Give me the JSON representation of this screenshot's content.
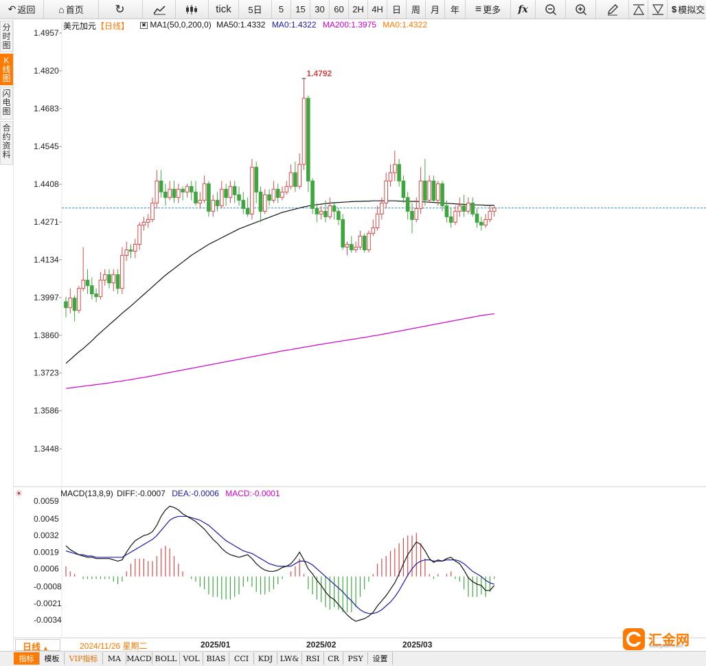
{
  "toolbar": {
    "back": "返回",
    "home": "首页",
    "tick": "tick",
    "five_day": "5日",
    "periods": [
      "5",
      "15",
      "30",
      "60",
      "2H",
      "4H",
      "日",
      "周",
      "月",
      "年"
    ],
    "more": "更多",
    "fx": "fx",
    "sim": "模拟交"
  },
  "left_tabs": [
    "分时图",
    "K线图",
    "闪电图",
    "合约资料"
  ],
  "main_legend": {
    "symbol": "美元加元",
    "period": "【日线】",
    "ma_set": "MA1(50,0,200,0)",
    "ma50": "MA50:1.4332",
    "ma0a": "MA0:1.4322",
    "ma200": "MA200:1.3975",
    "ma0b": "MA0:1.4322"
  },
  "macd_legend": {
    "name": "MACD(13,8,9)",
    "diff": "DIFF:-0.0007",
    "dea": "DEA:-0.0006",
    "macd": "MACD:-0.0001"
  },
  "max_label": "1.4792",
  "bottom": {
    "period": "日线",
    "date": "2024/11/26 星期二",
    "months": [
      "2025/01",
      "2025/02",
      "2025/03"
    ]
  },
  "tabs": [
    "指标",
    "模板",
    "VIP指标",
    "MA",
    "MACD",
    "BOLL",
    "VOL",
    "BIAS",
    "CCI",
    "KDJ",
    "LW&",
    "RSI",
    "CR",
    "PSY",
    "设置"
  ],
  "logo": {
    "text": "汇金网",
    "sub": "www.gold678.com"
  },
  "colors": {
    "up": "#d94848",
    "down": "#3fa63f",
    "ma50": "#111111",
    "ma200": "#cc00cc",
    "dea": "#1a1aa8",
    "accent": "#ff7a00"
  },
  "chart_data": [
    {
      "type": "candlestick",
      "title": "美元加元 日线",
      "y_ticks": [
        1.4957,
        1.482,
        1.4683,
        1.4545,
        1.4408,
        1.4271,
        1.4134,
        1.3997,
        1.386,
        1.3723,
        1.3586,
        1.3448
      ],
      "ylim": [
        1.3448,
        1.4957
      ],
      "current_price": 1.4322,
      "candles": [
        [
          1.3982,
          1.396,
          1.4,
          1.3925
        ],
        [
          1.396,
          1.3995,
          1.403,
          1.394
        ],
        [
          1.3995,
          1.395,
          1.4005,
          1.391
        ],
        [
          1.395,
          1.403,
          1.404,
          1.394
        ],
        [
          1.403,
          1.406,
          1.418,
          1.402
        ],
        [
          1.406,
          1.404,
          1.41,
          1.401
        ],
        [
          1.404,
          1.401,
          1.407,
          1.399
        ],
        [
          1.401,
          1.4,
          1.403,
          1.398
        ],
        [
          1.4,
          1.406,
          1.409,
          1.399
        ],
        [
          1.406,
          1.408,
          1.41,
          1.404
        ],
        [
          1.408,
          1.405,
          1.41,
          1.403
        ],
        [
          1.405,
          1.408,
          1.41,
          1.402
        ],
        [
          1.408,
          1.403,
          1.41,
          1.401
        ],
        [
          1.403,
          1.415,
          1.418,
          1.401
        ],
        [
          1.415,
          1.417,
          1.42,
          1.413
        ],
        [
          1.417,
          1.4165,
          1.419,
          1.414
        ],
        [
          1.4165,
          1.419,
          1.421,
          1.414
        ],
        [
          1.419,
          1.426,
          1.427,
          1.417
        ],
        [
          1.426,
          1.427,
          1.429,
          1.424
        ],
        [
          1.427,
          1.428,
          1.43,
          1.425
        ],
        [
          1.428,
          1.434,
          1.436,
          1.427
        ],
        [
          1.434,
          1.442,
          1.446,
          1.432
        ],
        [
          1.442,
          1.438,
          1.446,
          1.436
        ],
        [
          1.438,
          1.436,
          1.441,
          1.433
        ],
        [
          1.436,
          1.439,
          1.442,
          1.435
        ],
        [
          1.439,
          1.436,
          1.442,
          1.434
        ],
        [
          1.436,
          1.439,
          1.441,
          1.434
        ],
        [
          1.439,
          1.438,
          1.44,
          1.435
        ],
        [
          1.438,
          1.44,
          1.441,
          1.436
        ],
        [
          1.44,
          1.438,
          1.442,
          1.435
        ],
        [
          1.438,
          1.434,
          1.442,
          1.433
        ],
        [
          1.434,
          1.435,
          1.438,
          1.432
        ],
        [
          1.435,
          1.441,
          1.444,
          1.434
        ],
        [
          1.441,
          1.431,
          1.442,
          1.429
        ],
        [
          1.431,
          1.435,
          1.437,
          1.429
        ],
        [
          1.435,
          1.433,
          1.438,
          1.431
        ],
        [
          1.433,
          1.439,
          1.442,
          1.432
        ],
        [
          1.439,
          1.436,
          1.441,
          1.433
        ],
        [
          1.436,
          1.44,
          1.442,
          1.434
        ],
        [
          1.44,
          1.437,
          1.442,
          1.434
        ],
        [
          1.437,
          1.435,
          1.44,
          1.433
        ],
        [
          1.435,
          1.432,
          1.438,
          1.43
        ],
        [
          1.432,
          1.43,
          1.436,
          1.429
        ],
        [
          1.43,
          1.447,
          1.45,
          1.428
        ],
        [
          1.447,
          1.438,
          1.449,
          1.434
        ],
        [
          1.438,
          1.431,
          1.44,
          1.427
        ],
        [
          1.431,
          1.437,
          1.439,
          1.43
        ],
        [
          1.437,
          1.435,
          1.439,
          1.433
        ],
        [
          1.435,
          1.439,
          1.442,
          1.434
        ],
        [
          1.439,
          1.436,
          1.441,
          1.434
        ],
        [
          1.436,
          1.438,
          1.44,
          1.435
        ],
        [
          1.438,
          1.44,
          1.442,
          1.437
        ],
        [
          1.44,
          1.445,
          1.448,
          1.439
        ],
        [
          1.445,
          1.44,
          1.449,
          1.438
        ],
        [
          1.44,
          1.448,
          1.452,
          1.439
        ],
        [
          1.448,
          1.472,
          1.4792,
          1.446
        ],
        [
          1.472,
          1.442,
          1.473,
          1.438
        ],
        [
          1.442,
          1.432,
          1.443,
          1.43
        ],
        [
          1.432,
          1.43,
          1.434,
          1.427
        ],
        [
          1.43,
          1.431,
          1.433,
          1.428
        ],
        [
          1.431,
          1.429,
          1.435,
          1.427
        ],
        [
          1.429,
          1.433,
          1.436,
          1.428
        ],
        [
          1.433,
          1.431,
          1.434,
          1.428
        ],
        [
          1.431,
          1.428,
          1.432,
          1.426
        ],
        [
          1.428,
          1.418,
          1.43,
          1.417
        ],
        [
          1.418,
          1.419,
          1.42,
          1.415
        ],
        [
          1.419,
          1.417,
          1.422,
          1.416
        ],
        [
          1.417,
          1.418,
          1.42,
          1.416
        ],
        [
          1.418,
          1.422,
          1.424,
          1.417
        ],
        [
          1.422,
          1.417,
          1.423,
          1.416
        ],
        [
          1.417,
          1.423,
          1.424,
          1.416
        ],
        [
          1.423,
          1.425,
          1.428,
          1.422
        ],
        [
          1.425,
          1.43,
          1.433,
          1.424
        ],
        [
          1.43,
          1.434,
          1.436,
          1.428
        ],
        [
          1.434,
          1.442,
          1.445,
          1.432
        ],
        [
          1.442,
          1.445,
          1.448,
          1.44
        ],
        [
          1.445,
          1.448,
          1.453,
          1.442
        ],
        [
          1.448,
          1.442,
          1.45,
          1.44
        ],
        [
          1.442,
          1.436,
          1.444,
          1.434
        ],
        [
          1.436,
          1.431,
          1.438,
          1.428
        ],
        [
          1.431,
          1.428,
          1.434,
          1.423
        ],
        [
          1.428,
          1.432,
          1.436,
          1.427
        ],
        [
          1.432,
          1.442,
          1.447,
          1.43
        ],
        [
          1.442,
          1.435,
          1.45,
          1.433
        ],
        [
          1.435,
          1.442,
          1.444,
          1.434
        ],
        [
          1.442,
          1.435,
          1.444,
          1.434
        ],
        [
          1.435,
          1.441,
          1.442,
          1.433
        ],
        [
          1.441,
          1.433,
          1.442,
          1.431
        ],
        [
          1.433,
          1.429,
          1.435,
          1.427
        ],
        [
          1.429,
          1.427,
          1.432,
          1.425
        ],
        [
          1.427,
          1.431,
          1.433,
          1.426
        ],
        [
          1.431,
          1.433,
          1.436,
          1.429
        ],
        [
          1.433,
          1.431,
          1.437,
          1.429
        ],
        [
          1.431,
          1.434,
          1.436,
          1.43
        ],
        [
          1.434,
          1.43,
          1.436,
          1.429
        ],
        [
          1.43,
          1.427,
          1.432,
          1.425
        ],
        [
          1.427,
          1.426,
          1.429,
          1.424
        ],
        [
          1.426,
          1.428,
          1.43,
          1.425
        ],
        [
          1.428,
          1.431,
          1.433,
          1.427
        ],
        [
          1.431,
          1.4322,
          1.433,
          1.429
        ]
      ],
      "ma50": [
        1.3758,
        1.3772,
        1.3786,
        1.38,
        1.3812,
        1.3826,
        1.384,
        1.3856,
        1.387,
        1.3884,
        1.3898,
        1.3912,
        1.3926,
        1.394,
        1.3953,
        1.3966,
        1.398,
        1.3994,
        1.4008,
        1.4022,
        1.4036,
        1.405,
        1.4064,
        1.4078,
        1.409,
        1.4102,
        1.4114,
        1.4126,
        1.4138,
        1.415,
        1.416,
        1.417,
        1.418,
        1.419,
        1.4198,
        1.4206,
        1.4214,
        1.4222,
        1.423,
        1.4238,
        1.4246,
        1.4252,
        1.4258,
        1.4264,
        1.427,
        1.4276,
        1.4282,
        1.4288,
        1.4294,
        1.43,
        1.4306,
        1.431,
        1.4314,
        1.4318,
        1.4322,
        1.4326,
        1.4329,
        1.4332,
        1.4334,
        1.4336,
        1.4338,
        1.434,
        1.4341,
        1.4342,
        1.4343,
        1.4344,
        1.4345,
        1.4346,
        1.4346,
        1.4347,
        1.4347,
        1.4348,
        1.4348,
        1.4348,
        1.4348,
        1.4348,
        1.4348,
        1.4347,
        1.4347,
        1.4346,
        1.4346,
        1.4346,
        1.4345,
        1.4344,
        1.4343,
        1.4342,
        1.4341,
        1.434,
        1.4339,
        1.4338,
        1.4337,
        1.4336,
        1.4335,
        1.4334,
        1.4334,
        1.4333,
        1.4333,
        1.4332,
        1.4332,
        1.4332
      ],
      "ma200": [
        1.3667,
        1.3669,
        1.3671,
        1.3673,
        1.3675,
        1.3677,
        1.3679,
        1.3681,
        1.3683,
        1.3685,
        1.3687,
        1.369,
        1.3692,
        1.3694,
        1.3697,
        1.3699,
        1.3702,
        1.3705,
        1.3707,
        1.371,
        1.3713,
        1.3716,
        1.3719,
        1.3722,
        1.3725,
        1.3728,
        1.3731,
        1.3734,
        1.3737,
        1.374,
        1.3743,
        1.3746,
        1.3749,
        1.3752,
        1.3755,
        1.3758,
        1.3761,
        1.3764,
        1.3767,
        1.377,
        1.3773,
        1.3776,
        1.3779,
        1.3782,
        1.3785,
        1.3788,
        1.3791,
        1.3794,
        1.3797,
        1.38,
        1.3803,
        1.3806,
        1.3808,
        1.3811,
        1.3814,
        1.3817,
        1.3819,
        1.3822,
        1.3825,
        1.3827,
        1.383,
        1.3832,
        1.3835,
        1.3837,
        1.384,
        1.3842,
        1.3845,
        1.3847,
        1.385,
        1.3852,
        1.3855,
        1.3858,
        1.386,
        1.3863,
        1.3866,
        1.3869,
        1.3872,
        1.3875,
        1.3878,
        1.3881,
        1.3884,
        1.3887,
        1.389,
        1.3893,
        1.3896,
        1.3899,
        1.3902,
        1.3905,
        1.3908,
        1.3911,
        1.3914,
        1.3917,
        1.392,
        1.3923,
        1.3926,
        1.3929,
        1.3932,
        1.3934,
        1.3936,
        1.3938
      ]
    },
    {
      "type": "macd",
      "title": "MACD(13,8,9)",
      "y_ticks": [
        0.0059,
        0.0045,
        0.0032,
        0.0019,
        0.0006,
        -0.0008,
        -0.0021,
        -0.0034
      ],
      "ylim": [
        -0.0034,
        0.0059
      ],
      "diff": [
        0.0024,
        0.0021,
        0.0019,
        0.0017,
        0.0016,
        0.0015,
        0.0015,
        0.0014,
        0.0014,
        0.0014,
        0.0014,
        0.0013,
        0.0012,
        0.0013,
        0.0019,
        0.0024,
        0.0028,
        0.003,
        0.0032,
        0.0033,
        0.0035,
        0.004,
        0.0047,
        0.0052,
        0.0055,
        0.0054,
        0.0052,
        0.0049,
        0.0047,
        0.0045,
        0.0043,
        0.004,
        0.0037,
        0.0033,
        0.0029,
        0.0026,
        0.0022,
        0.0019,
        0.0017,
        0.0016,
        0.0015,
        0.0016,
        0.0017,
        0.0014,
        0.001,
        0.0007,
        0.0005,
        0.0004,
        0.0004,
        0.0005,
        0.0007,
        0.0008,
        0.001,
        0.0014,
        0.0019,
        0.0013,
        0.0006,
        0.0002,
        -0.0003,
        -0.0007,
        -0.0012,
        -0.0016,
        -0.0018,
        -0.0022,
        -0.0026,
        -0.003,
        -0.0033,
        -0.0035,
        -0.0034,
        -0.0033,
        -0.0031,
        -0.0028,
        -0.0023,
        -0.0019,
        -0.0015,
        -0.001,
        -0.0005,
        0.0002,
        0.001,
        0.0017,
        0.0022,
        0.0027,
        0.0025,
        0.002,
        0.0014,
        0.0011,
        0.0013,
        0.0012,
        0.0014,
        0.0015,
        0.0012,
        0.001,
        0.0005,
        -0.0001,
        -0.0004,
        -0.0006,
        -0.0007,
        -0.0011,
        -0.0011,
        -0.0007
      ],
      "dea": [
        0.002,
        0.0019,
        0.0018,
        0.0017,
        0.0017,
        0.0016,
        0.0016,
        0.0015,
        0.0015,
        0.0015,
        0.0015,
        0.0015,
        0.0015,
        0.0015,
        0.0017,
        0.0019,
        0.0021,
        0.0023,
        0.0025,
        0.0027,
        0.0029,
        0.0032,
        0.0036,
        0.004,
        0.0044,
        0.0046,
        0.0047,
        0.0047,
        0.0047,
        0.0046,
        0.0045,
        0.0044,
        0.0042,
        0.004,
        0.0037,
        0.0034,
        0.0031,
        0.0028,
        0.0026,
        0.0024,
        0.0022,
        0.002,
        0.0019,
        0.0018,
        0.0016,
        0.0014,
        0.0012,
        0.001,
        0.0009,
        0.0008,
        0.0008,
        0.0008,
        0.0008,
        0.001,
        0.0012,
        0.0012,
        0.0011,
        0.0009,
        0.0006,
        0.0003,
        0.0,
        -0.0003,
        -0.0006,
        -0.0009,
        -0.0012,
        -0.0016,
        -0.0019,
        -0.0023,
        -0.0026,
        -0.0028,
        -0.0029,
        -0.0029,
        -0.0028,
        -0.0026,
        -0.0023,
        -0.002,
        -0.0016,
        -0.0011,
        -0.0005,
        0.0001,
        0.0006,
        0.001,
        0.0012,
        0.0013,
        0.0013,
        0.0012,
        0.0012,
        0.0012,
        0.0013,
        0.0013,
        0.0013,
        0.0012,
        0.001,
        0.0007,
        0.0004,
        0.0002,
        0.0,
        -0.0003,
        -0.0005,
        -0.0006
      ]
    }
  ]
}
